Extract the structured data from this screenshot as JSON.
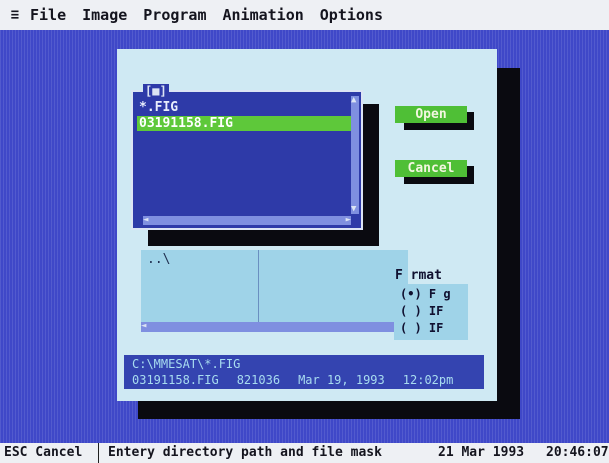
{
  "menubar": {
    "system_icon": "≡",
    "items": [
      "File",
      "Image",
      "Program",
      "Animation",
      "Options"
    ]
  },
  "file_list": {
    "title": "[■]",
    "items": [
      "*.FIG",
      "03191158.FIG"
    ],
    "selected_index": 1
  },
  "buttons": {
    "open": "Open",
    "cancel": "Cancel"
  },
  "directory_area": {
    "parent": "..\\"
  },
  "format": {
    "label": "F rmat",
    "options": [
      "(•) F g",
      "( ) IF",
      "( ) IF"
    ]
  },
  "info": {
    "path": "C:\\MMESAT\\*.FIG",
    "filename": "03191158.FIG",
    "size": "821036",
    "date": "Mar 19, 1993",
    "time": "12:02pm"
  },
  "statusbar": {
    "esc": "ESC Cancel",
    "hint": "Entery directory path and file mask",
    "date": "21 Mar 1993",
    "time": "20:46:07"
  },
  "colors": {
    "desktop": "#3f48c8",
    "dialog": "#cfe9f3",
    "list_bg": "#2e3aa8",
    "accent_green": "#4fbf36"
  }
}
